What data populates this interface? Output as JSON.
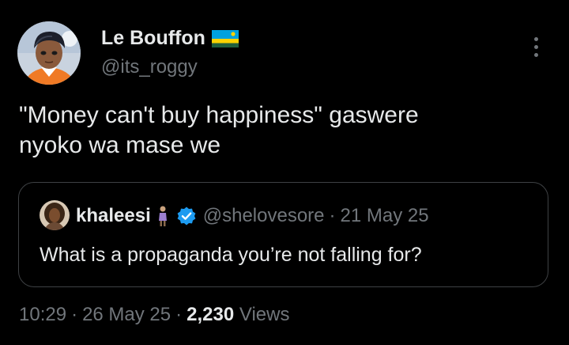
{
  "author": {
    "name": "Le Bouffon",
    "flag": "rwanda-flag-icon",
    "handle": "@its_roggy",
    "avatar": "anime-character-avatar"
  },
  "tweet": {
    "text": "\"Money can't buy happiness\" gaswere\nnyoko wa mase we"
  },
  "quote": {
    "name": "khaleesi",
    "emoji": "person-standing-icon",
    "verified": "verified-badge-icon",
    "handle": "@shelovesore",
    "separator": "·",
    "date": "21 May 25",
    "text": "What is a propaganda you’re not falling for?"
  },
  "meta": {
    "time": "10:29",
    "separator": "·",
    "date": "26 May 25",
    "views_count": "2,230",
    "views_label": "Views"
  },
  "colors": {
    "background": "#000000",
    "primary_text": "#e7e9ea",
    "secondary_text": "#71767b",
    "border": "#3e4144",
    "verified": "#1d9bf0"
  }
}
